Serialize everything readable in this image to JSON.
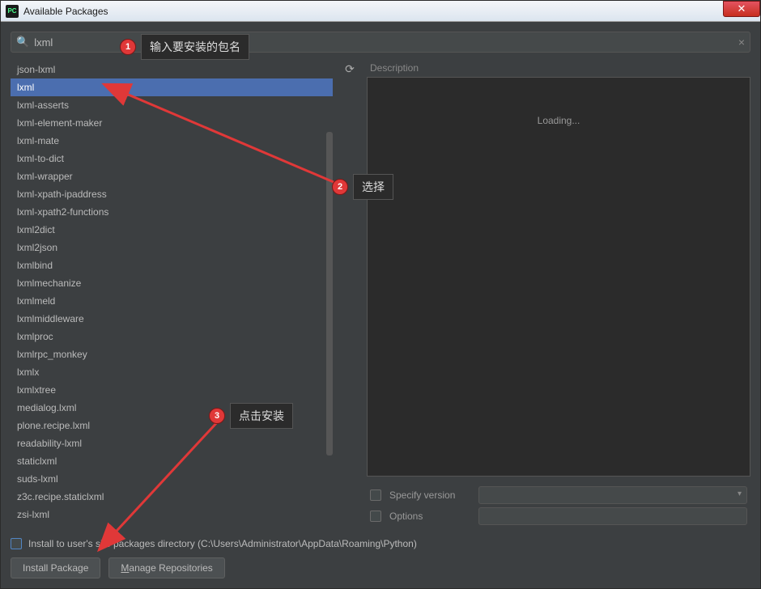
{
  "window": {
    "title": "Available Packages",
    "icon_text": "PC"
  },
  "search": {
    "value": "lxml",
    "placeholder": ""
  },
  "packages": [
    {
      "name": "json-lxml",
      "selected": false
    },
    {
      "name": "lxml",
      "selected": true
    },
    {
      "name": "lxml-asserts",
      "selected": false
    },
    {
      "name": "lxml-element-maker",
      "selected": false
    },
    {
      "name": "lxml-mate",
      "selected": false
    },
    {
      "name": "lxml-to-dict",
      "selected": false
    },
    {
      "name": "lxml-wrapper",
      "selected": false
    },
    {
      "name": "lxml-xpath-ipaddress",
      "selected": false
    },
    {
      "name": "lxml-xpath2-functions",
      "selected": false
    },
    {
      "name": "lxml2dict",
      "selected": false
    },
    {
      "name": "lxml2json",
      "selected": false
    },
    {
      "name": "lxmlbind",
      "selected": false
    },
    {
      "name": "lxmlmechanize",
      "selected": false
    },
    {
      "name": "lxmlmeld",
      "selected": false
    },
    {
      "name": "lxmlmiddleware",
      "selected": false
    },
    {
      "name": "lxmlproc",
      "selected": false
    },
    {
      "name": "lxmlrpc_monkey",
      "selected": false
    },
    {
      "name": "lxmlx",
      "selected": false
    },
    {
      "name": "lxmlxtree",
      "selected": false
    },
    {
      "name": "medialog.lxml",
      "selected": false
    },
    {
      "name": "plone.recipe.lxml",
      "selected": false
    },
    {
      "name": "readability-lxml",
      "selected": false
    },
    {
      "name": "staticlxml",
      "selected": false
    },
    {
      "name": "suds-lxml",
      "selected": false
    },
    {
      "name": "z3c.recipe.staticlxml",
      "selected": false
    },
    {
      "name": "zsi-lxml",
      "selected": false
    }
  ],
  "description": {
    "header": "Description",
    "loading": "Loading..."
  },
  "options": {
    "specify_version_label": "Specify version",
    "options_label": "Options"
  },
  "install_user": {
    "label": "Install to user's site packages directory (C:\\Users\\Administrator\\AppData\\Roaming\\Python)"
  },
  "buttons": {
    "install": "Install Package",
    "manage": "Manage Repositories",
    "manage_key": "M"
  },
  "annotations": {
    "a1": {
      "num": "1",
      "text": "输入要安装的包名"
    },
    "a2": {
      "num": "2",
      "text": "选择"
    },
    "a3": {
      "num": "3",
      "text": "点击安装"
    }
  }
}
